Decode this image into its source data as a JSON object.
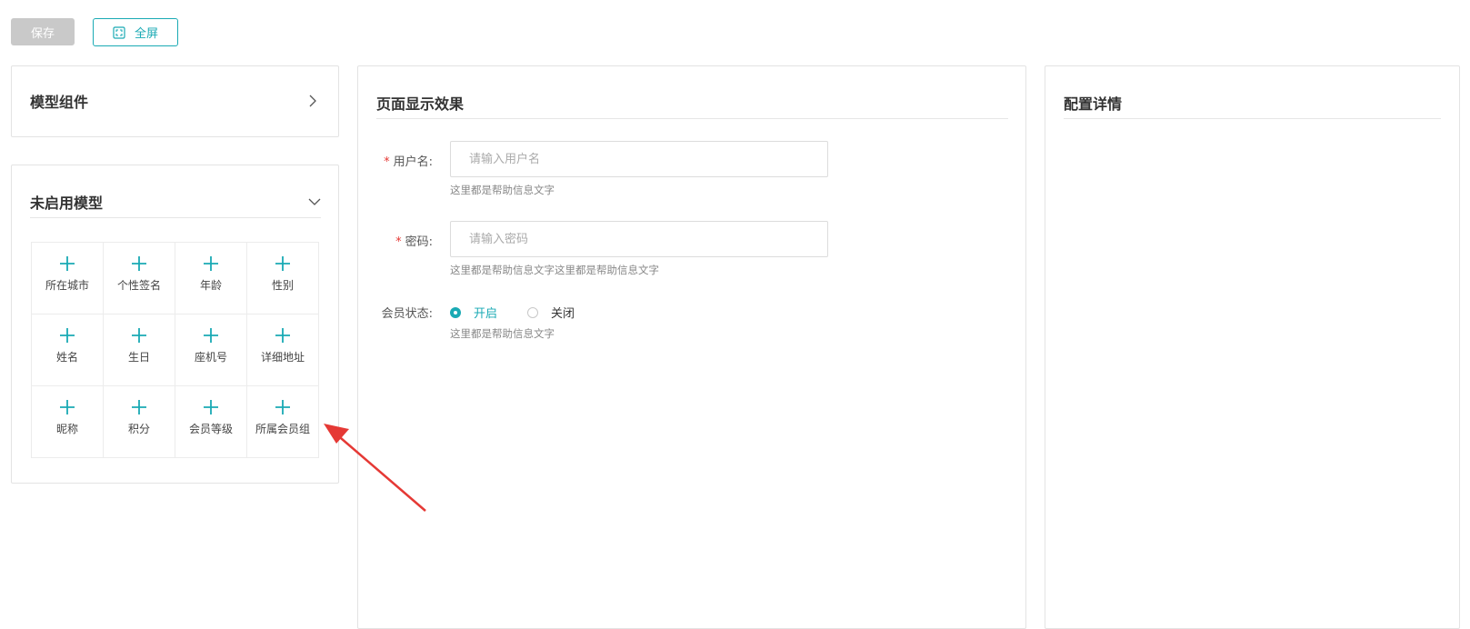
{
  "toolbar": {
    "save_label": "保存",
    "fullscreen_label": "全屏"
  },
  "colors": {
    "accent": "#1aaab4",
    "disabled": "#c9c9c9",
    "required": "#e53935",
    "arrow": "#e53935"
  },
  "left": {
    "components_title": "模型组件",
    "unused_title": "未启用模型",
    "models": [
      "所在城市",
      "个性签名",
      "年龄",
      "性别",
      "姓名",
      "生日",
      "座机号",
      "详细地址",
      "昵称",
      "积分",
      "会员等级",
      "所属会员组"
    ]
  },
  "preview": {
    "title": "页面显示效果",
    "username": {
      "required_mark": "*",
      "label": "用户名:",
      "placeholder": "请输入用户名",
      "help": "这里都是帮助信息文字"
    },
    "password": {
      "required_mark": "*",
      "label": "密码:",
      "placeholder": "请输入密码",
      "help": "这里都是帮助信息文字这里都是帮助信息文字"
    },
    "member_status": {
      "label": "会员状态:",
      "on_label": "开启",
      "off_label": "关闭",
      "selected": "开启",
      "help": "这里都是帮助信息文字"
    }
  },
  "config": {
    "title": "配置详情"
  }
}
